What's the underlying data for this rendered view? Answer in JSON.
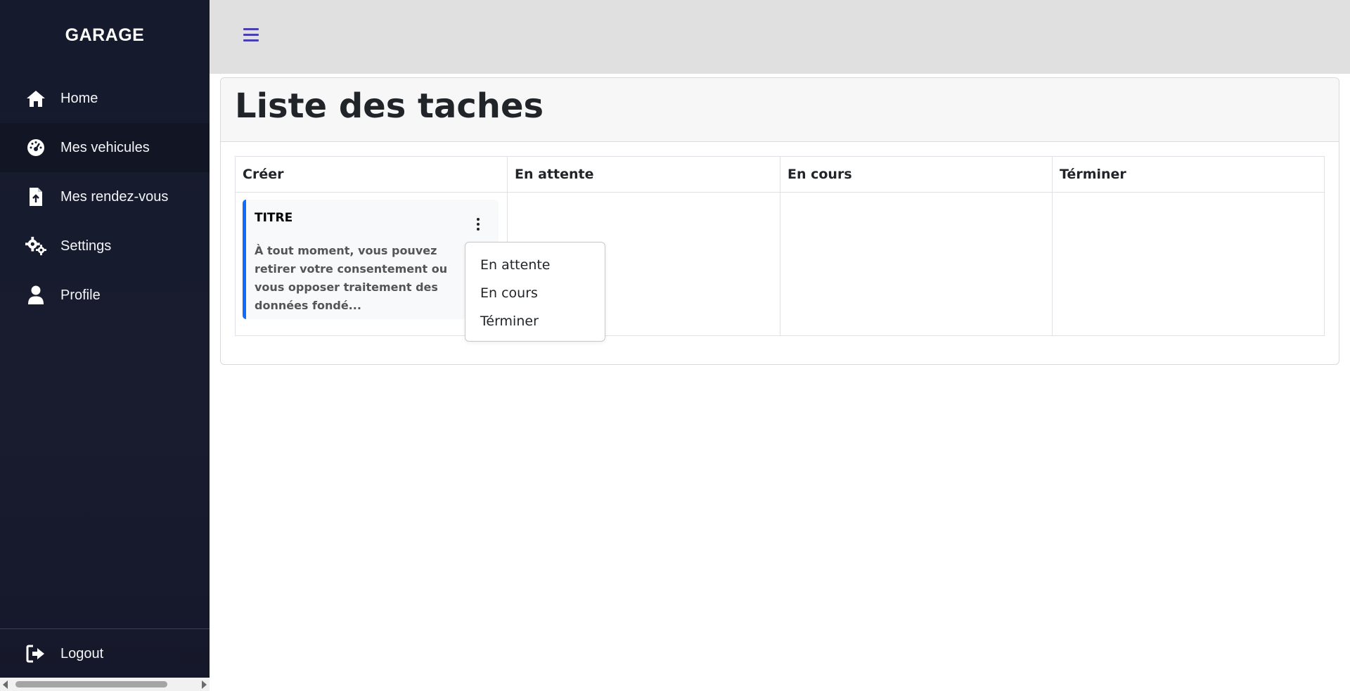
{
  "sidebar": {
    "brand": "GARAGE",
    "items": [
      {
        "label": "Home",
        "icon": "home-icon"
      },
      {
        "label": "Mes vehicules",
        "icon": "gauge-icon"
      },
      {
        "label": "Mes rendez-vous",
        "icon": "file-upload-icon"
      },
      {
        "label": "Settings",
        "icon": "gears-icon"
      },
      {
        "label": "Profile",
        "icon": "user-icon"
      }
    ],
    "logout": {
      "label": "Logout",
      "icon": "sign-out-icon"
    }
  },
  "topbar": {
    "menu_icon": "hamburger-icon"
  },
  "page": {
    "title": "Liste des taches"
  },
  "board": {
    "columns": [
      "Créer",
      "En attente",
      "En cours",
      "Términer"
    ],
    "tasks": [
      {
        "column": "Créer",
        "title": "TITRE",
        "body": "À tout moment, vous pouvez retirer votre consentement ou vous opposer traitement des données fondé..."
      }
    ]
  },
  "dropdown": {
    "items": [
      "En attente",
      "En cours",
      "Términer"
    ]
  },
  "colors": {
    "sidebar_bg": "#161a2d",
    "topbar_bg": "#e0e0e0",
    "accent": "#0d6efd",
    "hamburger": "#4a3fb0"
  }
}
